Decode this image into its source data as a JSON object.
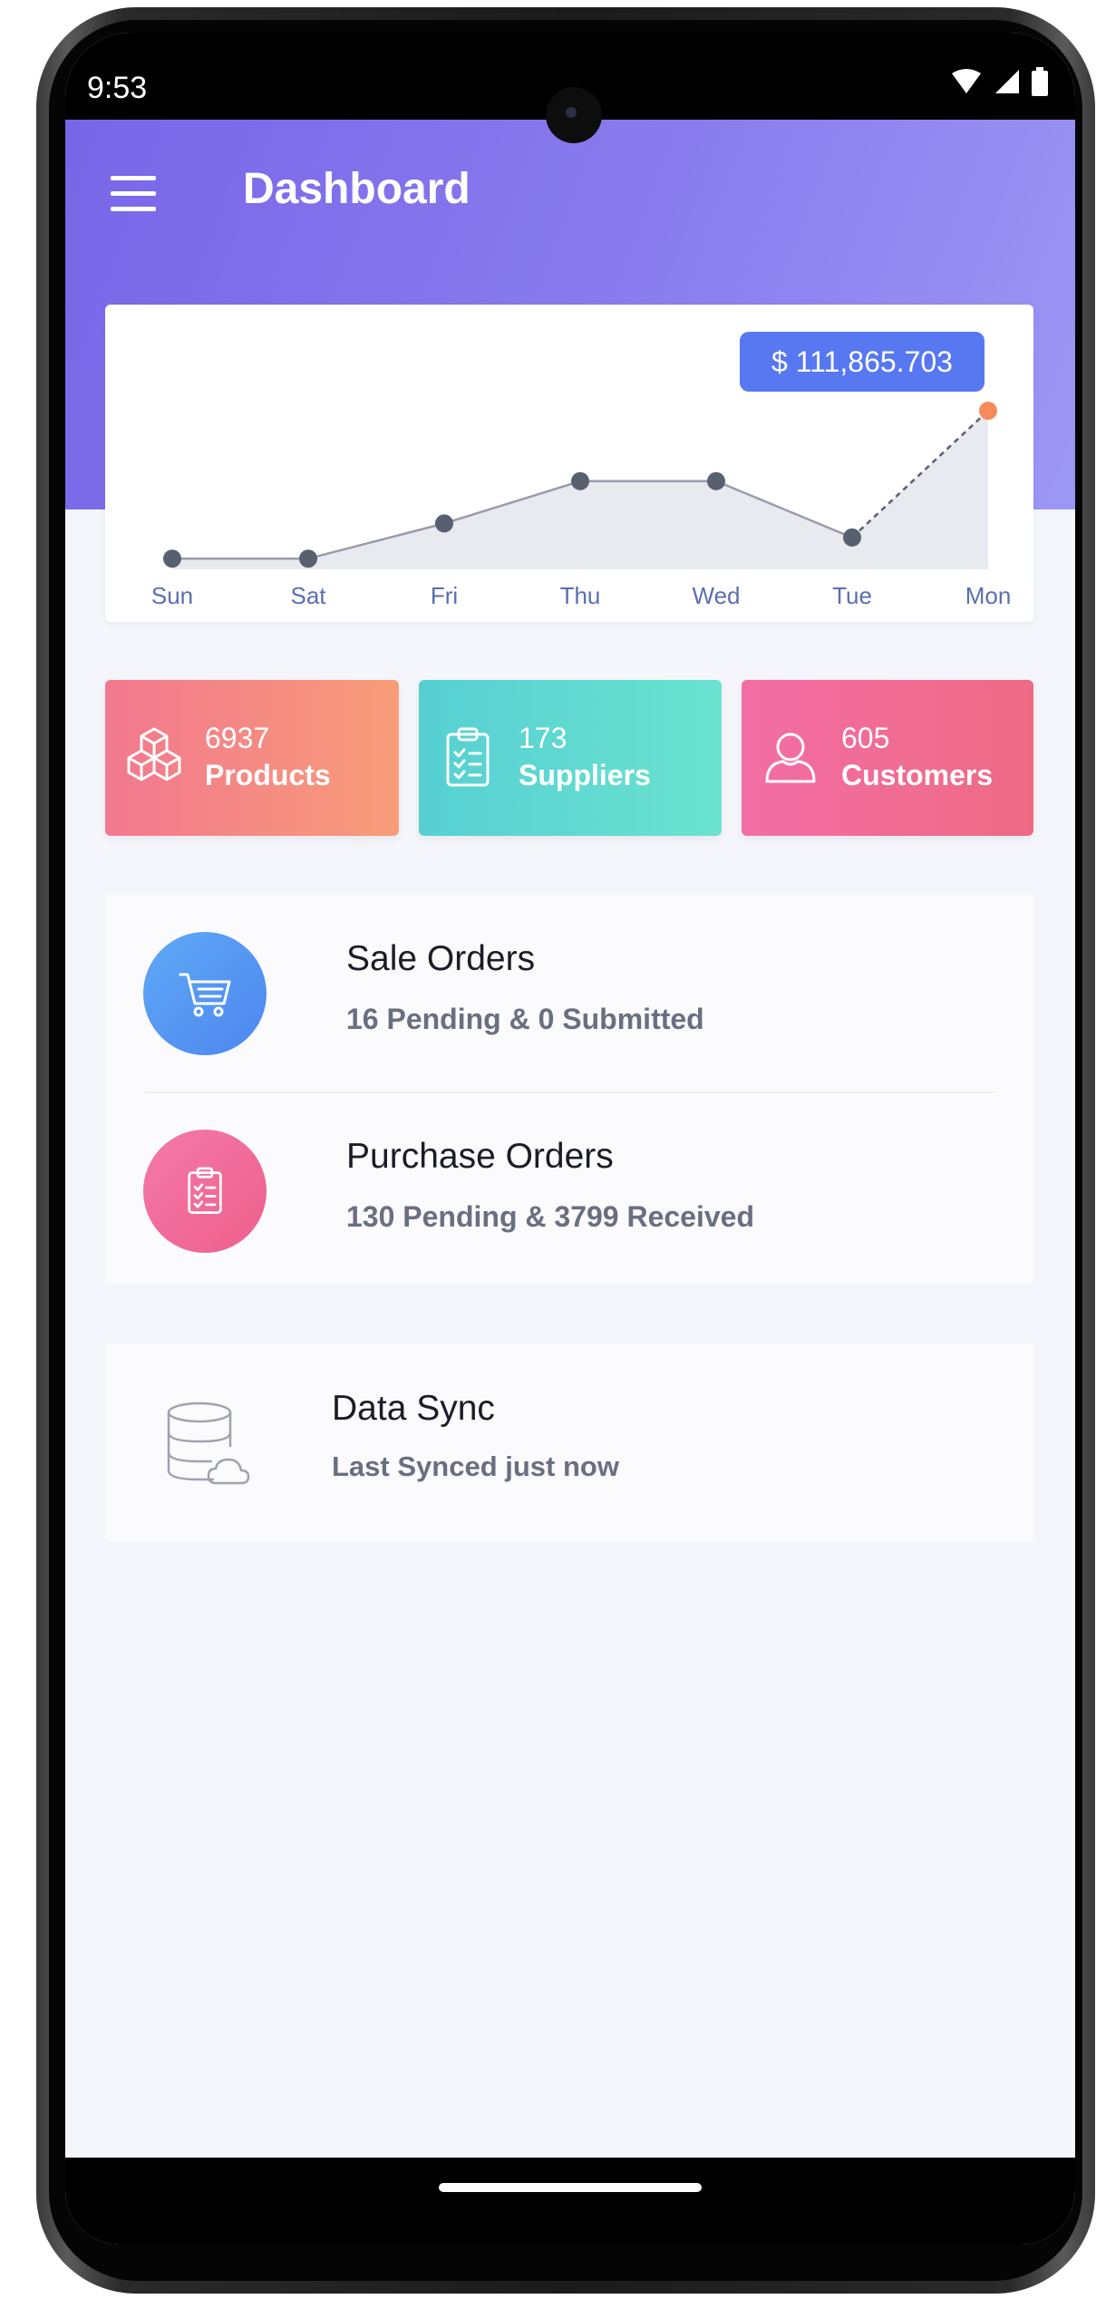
{
  "status_bar": {
    "time": "9:53"
  },
  "header": {
    "title": "Dashboard"
  },
  "chart": {
    "total_badge": "$ 111,865.703"
  },
  "chart_data": {
    "type": "line",
    "categories": [
      "Sun",
      "Sat",
      "Fri",
      "Thu",
      "Wed",
      "Tue",
      "Mon"
    ],
    "values": [
      1,
      1,
      6,
      12,
      12,
      4,
      22
    ],
    "title": "",
    "xlabel": "",
    "ylabel": "",
    "ylim": [
      0,
      26
    ],
    "grid": false,
    "highlight_last": true,
    "colors": {
      "line": "#9a9cab",
      "point": "#58606f",
      "last_point": "#f78a5a",
      "fill": "#e8eaf0",
      "label": "#5a6fb0"
    }
  },
  "stats": {
    "products": {
      "count": "6937",
      "label": "Products"
    },
    "suppliers": {
      "count": "173",
      "label": "Suppliers"
    },
    "customers": {
      "count": "605",
      "label": "Customers"
    }
  },
  "orders": {
    "sale": {
      "title": "Sale Orders",
      "subtitle": "16 Pending & 0 Submitted"
    },
    "purchase": {
      "title": "Purchase Orders",
      "subtitle": "130 Pending & 3799 Received"
    }
  },
  "sync": {
    "title": "Data Sync",
    "subtitle": "Last Synced just now"
  },
  "icons": {
    "menu": "menu-icon",
    "products": "cubes-icon",
    "suppliers": "clipboard-icon",
    "customers": "user-icon",
    "sale": "cart-icon",
    "purchase": "clipboard-check-icon",
    "sync": "database-cloud-icon"
  }
}
